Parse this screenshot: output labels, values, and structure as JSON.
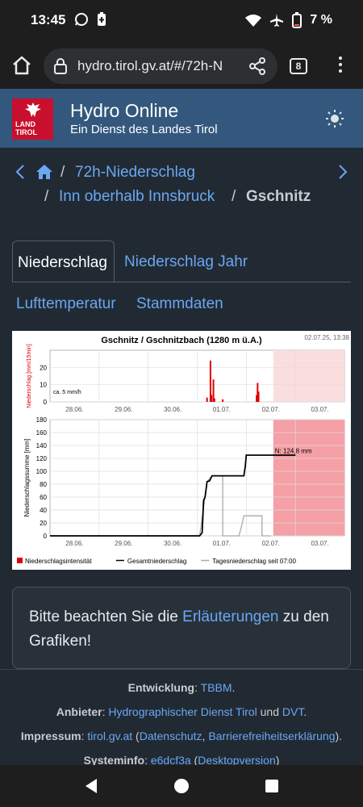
{
  "status": {
    "time": "13:45",
    "battery": "7 %"
  },
  "browser": {
    "url": "hydro.tirol.gv.at/#/72h-N",
    "tab_count": "8"
  },
  "header": {
    "logo_text": "LAND TIROL",
    "title": "Hydro Online",
    "subtitle": "Ein Dienst des Landes Tirol"
  },
  "breadcrumb": {
    "sep": "/",
    "item1": "72h-Niederschlag",
    "item2": "Inn oberhalb Innsbruck",
    "current": "Gschnitz"
  },
  "tabs": {
    "active": "Niederschlag",
    "t2": "Niederschlag Jahr",
    "t3": "Lufttemperatur",
    "t4": "Stammdaten"
  },
  "chart_data": {
    "title": "Gschnitz / Gschnitzbach (1280 m ü.A.)",
    "timestamp": "02.07.25, 13:38",
    "categories": [
      "28.06.",
      "29.06.",
      "30.06.",
      "01.07.",
      "02.07.",
      "03.07."
    ],
    "top_panel": {
      "type": "bar",
      "ylabel": "Niederschlag [mm/15min]",
      "ylim": [
        0,
        30
      ],
      "yticks": [
        0,
        10,
        20
      ],
      "annotation": "ca. 5 mm/h",
      "bars": [
        {
          "t": 3.2,
          "v": 2.5
        },
        {
          "t": 3.27,
          "v": 24
        },
        {
          "t": 3.29,
          "v": 4
        },
        {
          "t": 3.33,
          "v": 13
        },
        {
          "t": 3.35,
          "v": 2
        },
        {
          "t": 3.52,
          "v": 1.5
        },
        {
          "t": 4.21,
          "v": 4
        },
        {
          "t": 4.23,
          "v": 11
        },
        {
          "t": 4.25,
          "v": 6
        }
      ]
    },
    "bottom_panel": {
      "type": "line",
      "ylabel": "Niederschlagssumme [mm]",
      "ylim": [
        0,
        180
      ],
      "yticks": [
        0,
        20,
        40,
        60,
        80,
        100,
        120,
        140,
        160,
        180
      ],
      "annotation": "N: 124,8 mm",
      "series": [
        {
          "name": "Gesamtniederschlag",
          "color": "#000000",
          "x": [
            0.0,
            3.05,
            3.1,
            3.13,
            3.16,
            3.2,
            3.25,
            3.3,
            3.35,
            3.4,
            3.95,
            3.98,
            4.0,
            4.3,
            4.35,
            4.4,
            5.0
          ],
          "y": [
            0,
            0,
            5,
            55,
            60,
            84,
            85,
            93,
            93,
            93,
            93,
            108,
            125,
            125,
            125,
            125,
            125
          ]
        },
        {
          "name": "Tagesniederschlag seit 07:00",
          "color": "#aaaaaa",
          "x": [
            0.0,
            3.05,
            3.2,
            3.3,
            3.5,
            3.52,
            3.52,
            3.85,
            3.9,
            3.95,
            4.3,
            4.32,
            4.32,
            4.5
          ],
          "y": [
            0,
            0,
            84,
            93,
            93,
            93,
            0,
            0,
            14,
            31,
            31,
            31,
            0,
            0
          ]
        }
      ],
      "forecast_start": 4.55,
      "forecast_end": 5.5
    },
    "legend": [
      {
        "name": "Niederschlagsintensität",
        "color": "#e00000"
      },
      {
        "name": "Gesamtniederschlag",
        "color": "#000000"
      },
      {
        "name": "Tagesniederschlag seit 07:00",
        "color": "#aaaaaa"
      }
    ]
  },
  "notice": {
    "before": "Bitte beachten Sie die ",
    "link": "Erläuterungen",
    "after": " zu den Grafiken!"
  },
  "footer": {
    "dev_label": "Entwicklung",
    "dev_link": "TBBM",
    "provider_label": "Anbieter",
    "provider_link": "Hydrographischer Dienst Tirol",
    "and": "und",
    "provider_link2": "DVT",
    "impressum_label": "Impressum",
    "impressum_link": "tirol.gv.at",
    "privacy_link": "Datenschutz",
    "accessibility_link": "Barrierefreiheitserklärung",
    "sysinfo_label": "Systeminfo",
    "sysinfo_link": "e6dcf3a",
    "desktop_link": "Desktopversion"
  }
}
